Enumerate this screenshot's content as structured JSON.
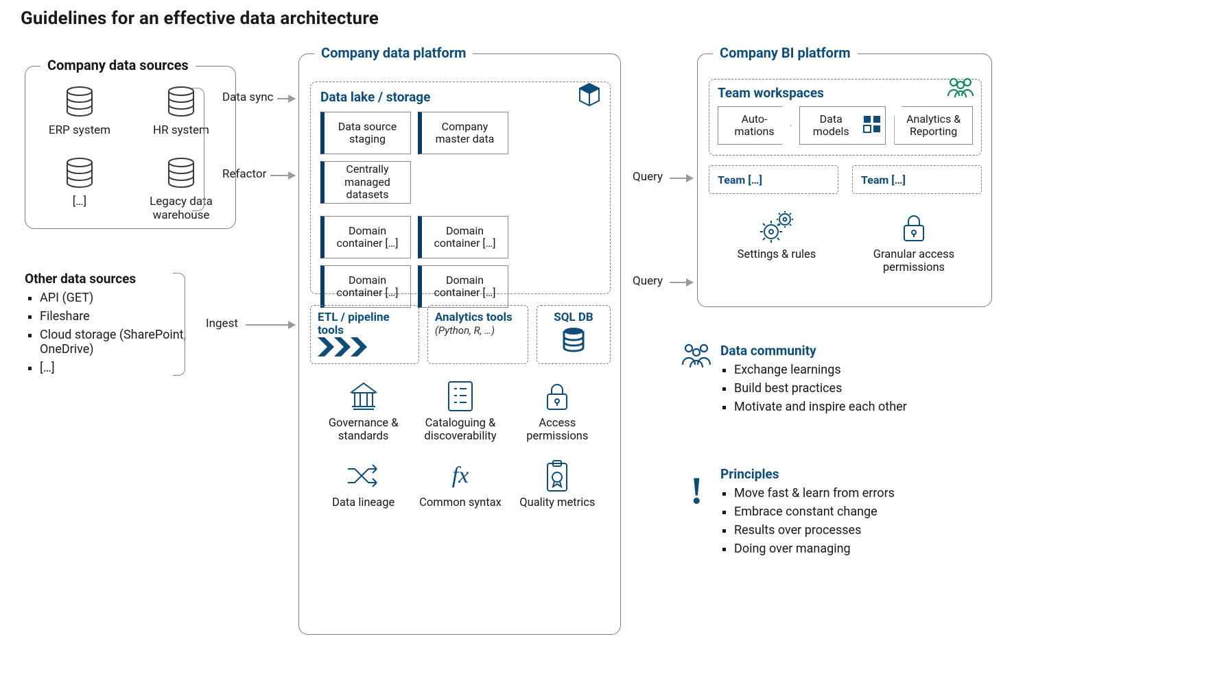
{
  "title": "Guidelines for an effective data architecture",
  "sources_company": {
    "title": "Company data sources",
    "items": [
      "ERP system",
      "HR system",
      "[…]",
      "Legacy data warehouse"
    ]
  },
  "sources_other": {
    "title": "Other data sources",
    "items": [
      "API (GET)",
      "Fileshare",
      "Cloud storage (SharePoint, OneDrive)",
      "[…]"
    ]
  },
  "flows": {
    "sync": "Data sync",
    "refactor": "Refactor",
    "ingest": "Ingest",
    "query": "Query"
  },
  "platform": {
    "title": "Company data platform",
    "datalake_title": "Data lake / storage",
    "dl_top": [
      "Data source staging",
      "Company master data",
      "Centrally managed datasets"
    ],
    "dl_domain": [
      "Domain container […]",
      "Domain container […]",
      "Domain container […]",
      "Domain container […]"
    ],
    "tools": {
      "etl": "ETL / pipeline tools",
      "ana_t": "Analytics tools",
      "ana_s": "(Python, R, …)",
      "sql": "SQL DB"
    },
    "feats": [
      "Governance & standards",
      "Cataloguing & discoverability",
      "Access permissions",
      "Data lineage",
      "Common syntax",
      "Quality metrics"
    ]
  },
  "bi": {
    "title": "Company BI platform",
    "tw_title": "Team workspaces",
    "tw_items": [
      "Auto-mations",
      "Data models",
      "Analytics & Reporting"
    ],
    "team_pill": "Team […]",
    "feats": [
      "Settings & rules",
      "Granular access permissions"
    ]
  },
  "community": {
    "title": "Data community",
    "items": [
      "Exchange learnings",
      "Build best practices",
      "Motivate and inspire each other"
    ]
  },
  "principles": {
    "title": "Principles",
    "items": [
      "Move fast & learn from errors",
      "Embrace constant change",
      "Results over processes",
      "Doing over managing"
    ]
  }
}
